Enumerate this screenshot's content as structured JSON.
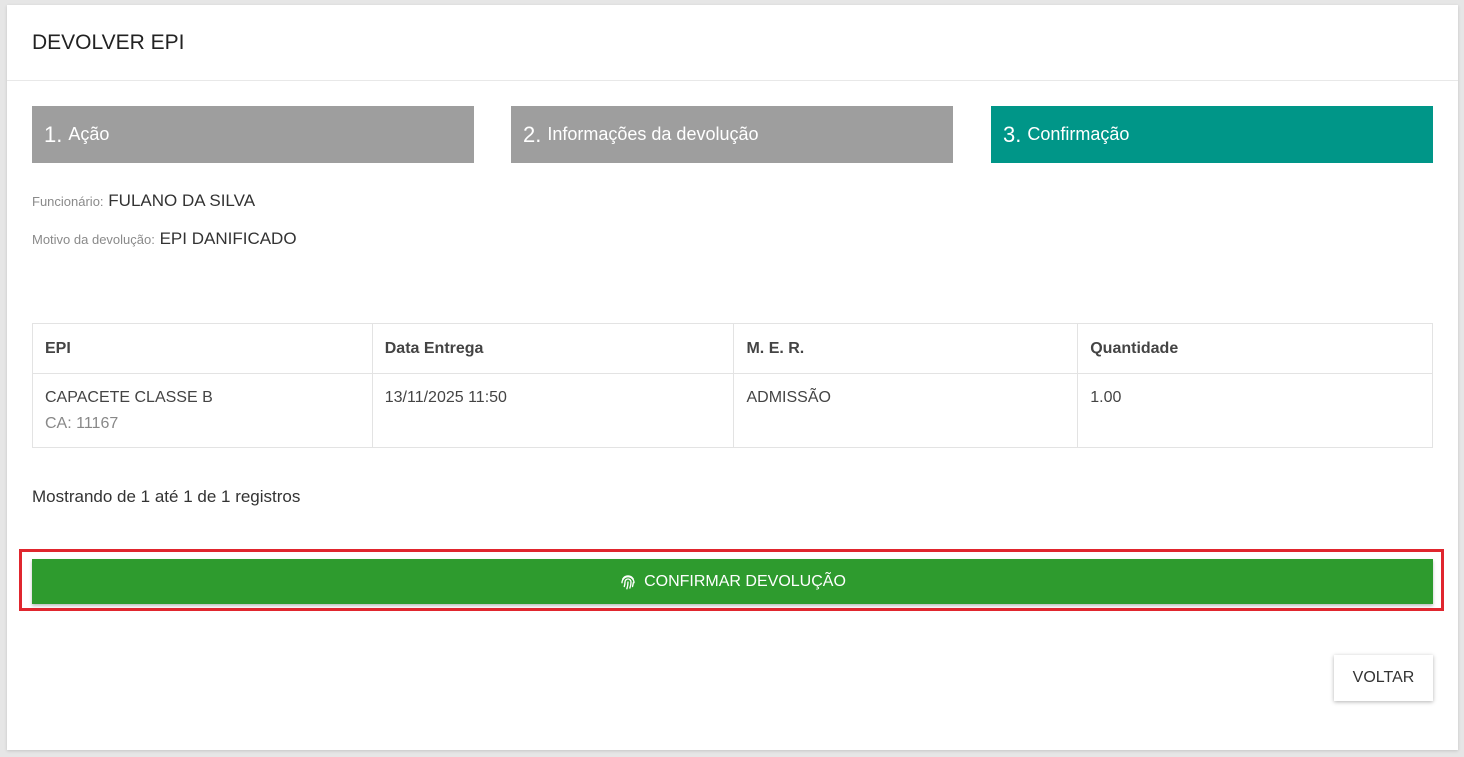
{
  "header": {
    "title": "DEVOLVER EPI"
  },
  "steps": [
    {
      "num": "1.",
      "label": "Ação",
      "active": false
    },
    {
      "num": "2.",
      "label": "Informações da devolução",
      "active": false
    },
    {
      "num": "3.",
      "label": "Confirmação",
      "active": true
    }
  ],
  "info": {
    "employee_label": "Funcionário:",
    "employee_value": "FULANO DA SILVA",
    "reason_label": "Motivo da devolução:",
    "reason_value": "EPI DANIFICADO"
  },
  "table": {
    "columns": [
      "EPI",
      "Data Entrega",
      "M. E. R.",
      "Quantidade"
    ],
    "rows": [
      {
        "epi": "CAPACETE CLASSE B",
        "ca": "CA: 11167",
        "date": "13/11/2025 11:50",
        "mer": "ADMISSÃO",
        "qty": "1.00"
      }
    ]
  },
  "records_text": "Mostrando de 1 até 1 de 1 registros",
  "confirm_button": {
    "label": "CONFIRMAR DEVOLUÇÃO",
    "icon": "fingerprint-icon"
  },
  "back_button": {
    "label": "VOLTAR"
  },
  "colors": {
    "active_step": "#009688",
    "inactive_step": "#9e9e9e",
    "confirm": "#2e9b2e",
    "highlight": "#e0262e"
  }
}
